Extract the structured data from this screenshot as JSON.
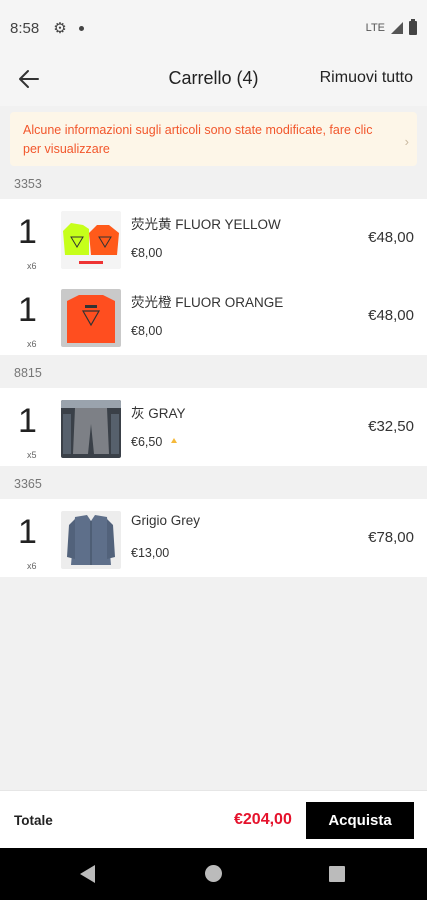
{
  "status_bar": {
    "time": "8:58",
    "network": "LTE"
  },
  "app_bar": {
    "title": "Carrello (4)",
    "remove_all": "Rimuovi tutto"
  },
  "notice": {
    "text": "Alcune informazioni sugli articoli sono state modificate, fare clic per visualizzare"
  },
  "groups": [
    {
      "label": "3353",
      "items": [
        {
          "qty": "1",
          "multiplier": "x6",
          "name": "荧光黄 FLUOR YELLOW",
          "unit_price": "€8,00",
          "price": "€48,00"
        },
        {
          "qty": "1",
          "multiplier": "x6",
          "name": "荧光橙 FLUOR ORANGE",
          "unit_price": "€8,00",
          "price": "€48,00"
        }
      ]
    },
    {
      "label": "8815",
      "items": [
        {
          "qty": "1",
          "multiplier": "x5",
          "name": "灰 GRAY",
          "unit_price": "€6,50",
          "price": "€32,50"
        }
      ]
    },
    {
      "label": "3365",
      "items": [
        {
          "qty": "1",
          "multiplier": "x6",
          "name": "Grigio Grey",
          "unit_price": "€13,00",
          "price": "€78,00"
        }
      ]
    }
  ],
  "footer": {
    "total_label": "Totale",
    "total_value": "€204,00",
    "buy_label": "Acquista"
  },
  "colors": {
    "accent_red": "#e5122c",
    "notice_text": "#f2572c",
    "notice_bg": "#fdf6e8"
  }
}
